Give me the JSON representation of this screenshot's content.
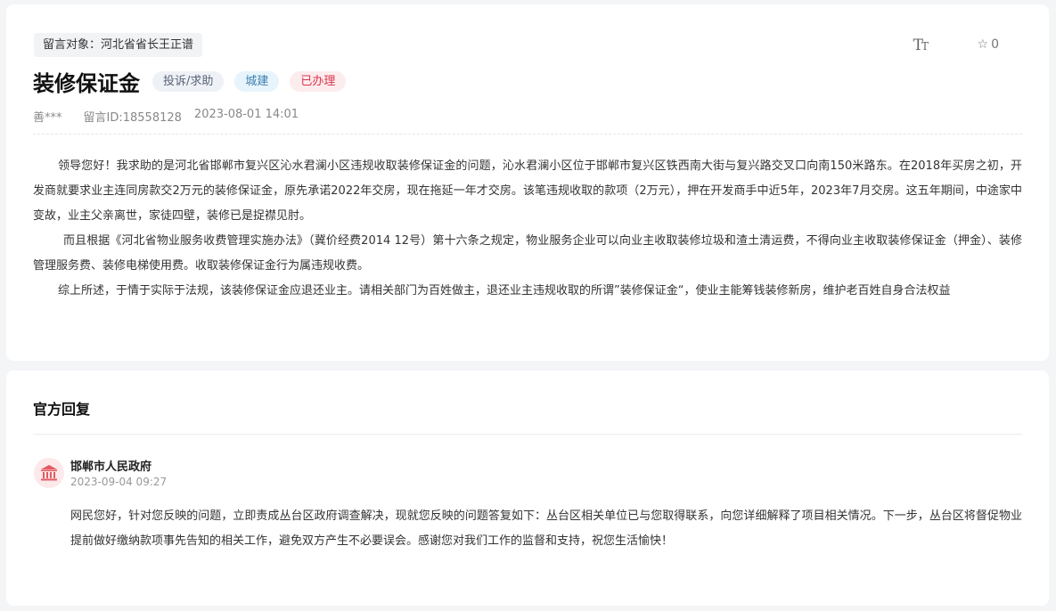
{
  "message": {
    "target_label": "留言对象：河北省省长王正谱",
    "font_toggle_big": "T",
    "font_toggle_small": "T",
    "favorite_count": "0",
    "title": "装修保证金",
    "tags": [
      "投诉/求助",
      "城建",
      "已办理"
    ],
    "author": "善***",
    "message_id": "留言ID:18558128",
    "datetime": "2023-08-01 14:01",
    "paragraphs": [
      "领导您好！我求助的是河北省邯郸市复兴区沁水君澜小区违规收取装修保证金的问题，沁水君澜小区位于邯郸市复兴区铁西南大街与复兴路交叉口向南150米路东。在2018年买房之初，开发商就要求业主连同房款交2万元的装修保证金，原先承诺2022年交房，现在拖延一年才交房。该笔违规收取的款项（2万元），押在开发商手中近5年，2023年7月交房。这五年期间，中途家中变故，业主父亲离世，家徒四壁，装修已是捉襟见肘。",
      "而且根据《河北省物业服务收费管理实施办法》（冀价经费2014 12号）第十六条之规定，物业服务企业可以向业主收取装修垃圾和渣土清运费，不得向业主收取装修保证金（押金）、装修管理服务费、装修电梯使用费。收取装修保证金行为属违规收费。",
      "综上所述，于情于实际于法规，该装修保证金应退还业主。请相关部门为百姓做主，退还业主违规收取的所谓”装修保证金“，使业主能筹钱装修新房，维护老百姓自身合法权益"
    ]
  },
  "reply": {
    "section_title": "官方回复",
    "org_name": "邯郸市人民政府",
    "datetime": "2023-09-04 09:27",
    "content": "网民您好，针对您反映的问题，立即责成丛台区政府调查解决，现就您反映的问题答复如下：丛台区相关单位已与您取得联系，向您详细解释了项目相关情况。下一步，丛台区将督促物业提前做好缴纳款项事先告知的相关工作，避免双方产生不必要误会。感谢您对我们工作的监督和支持，祝您生活愉快！"
  },
  "icons": {
    "font_size": "font-size-icon",
    "favorite": "star-outline-icon",
    "org": "government-building-icon"
  },
  "colors": {
    "tag_red": "#d9354a",
    "tag_blue": "#3a7fb0",
    "avatar_icon": "#e25b62"
  }
}
